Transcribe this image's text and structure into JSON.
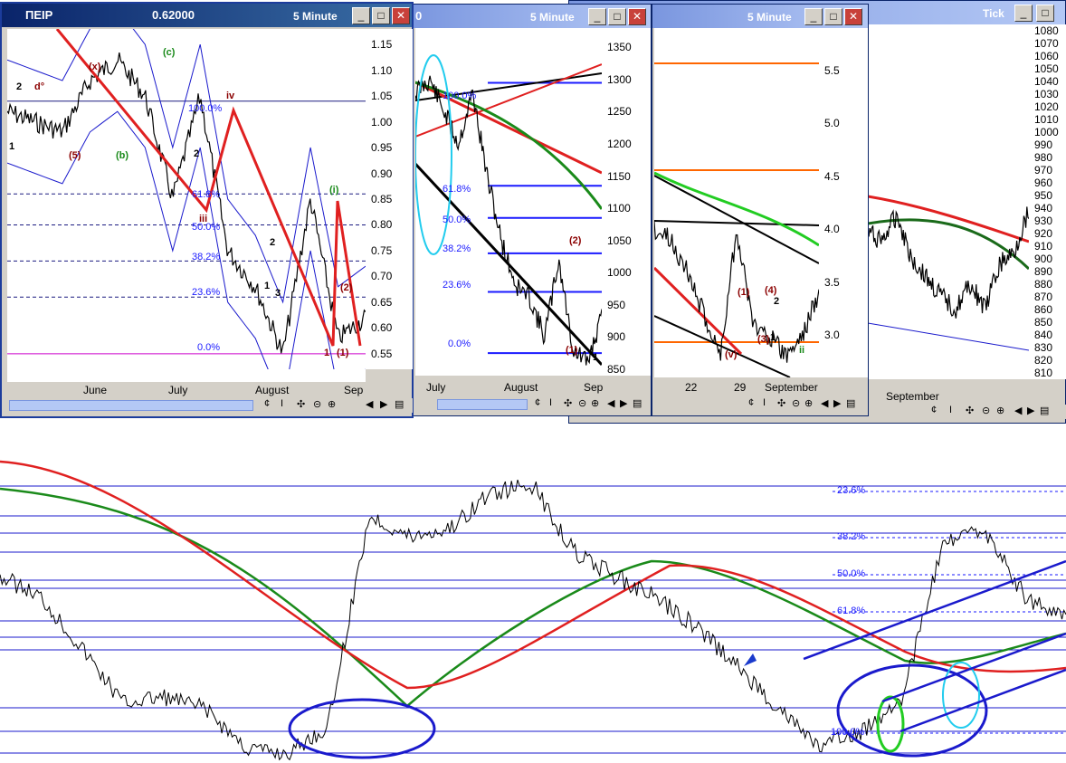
{
  "windows": [
    {
      "symbol": "ΠΕΙΡ",
      "value": "0.62000",
      "interval": "5 Minute",
      "y_ticks": [
        "1.15",
        "1.10",
        "1.05",
        "1.00",
        "0.95",
        "0.90",
        "0.85",
        "0.80",
        "0.75",
        "0.70",
        "0.65",
        "0.60",
        "0.55"
      ],
      "x_ticks": [
        "June",
        "July",
        "August",
        "Sep"
      ],
      "fib_levels": [
        "100.0%",
        "61.8%",
        "50.0%",
        "38.2%",
        "23.6%",
        "0.0%"
      ],
      "wave_labels": [
        "(x)",
        "(c)",
        "2",
        "d°",
        "1",
        "(5)",
        "(b)",
        "iv",
        "iii",
        "2",
        "(i)",
        "(1)",
        "(2)",
        "1",
        "1",
        "2",
        "3"
      ]
    },
    {
      "symbol": "0",
      "interval": "5 Minute",
      "y_ticks": [
        "1350",
        "1300",
        "1250",
        "1200",
        "1150",
        "1100",
        "1050",
        "1000",
        "950",
        "900",
        "850"
      ],
      "x_ticks": [
        "July",
        "August",
        "Sep"
      ],
      "fib_levels": [
        "100.0%",
        "61.8%",
        "50.0%",
        "38.2%",
        "23.6%",
        "0.0%"
      ],
      "wave_labels": [
        "(2)",
        "(1)",
        "1"
      ]
    },
    {
      "interval": "5 Minute",
      "y_ticks": [
        "5.5",
        "5.0",
        "4.5",
        "4.0",
        "3.5",
        "3.0"
      ],
      "x_ticks": [
        "22",
        "29",
        "September"
      ],
      "wave_labels": [
        "(v)",
        "(1)",
        "(4)",
        "(3)",
        "ii",
        "1",
        "2"
      ]
    },
    {
      "interval": "Tick",
      "y_ticks": [
        "1080",
        "1070",
        "1060",
        "1050",
        "1040",
        "1030",
        "1020",
        "1010",
        "1000",
        "990",
        "980",
        "970",
        "960",
        "950",
        "940",
        "930",
        "920",
        "910",
        "900",
        "890",
        "880",
        "870",
        "860",
        "850",
        "840",
        "830",
        "820",
        "810"
      ],
      "x_ticks": [
        "September"
      ]
    }
  ],
  "toolbar_icons": [
    "¢",
    "I",
    "✣",
    "⊝",
    "⊕",
    "◀",
    "▶",
    "▤"
  ],
  "main_chart": {
    "fib_levels": [
      "23.6%",
      "38.2%",
      "50.0%",
      "61.8%",
      "100.0%"
    ]
  },
  "colors": {
    "moving_avg_fast": "#1a8a1a",
    "moving_avg_slow": "#e02020",
    "bands": "#1a1acc",
    "fib_lines": "#1a1aff",
    "price": "#000000"
  },
  "chart_data": [
    {
      "type": "line",
      "symbol": "ΠΕΙΡ",
      "interval": "5 Minute",
      "last_value": 0.62,
      "ylim": [
        0.52,
        1.18
      ],
      "categories": [
        "June",
        "July",
        "August",
        "Sep"
      ],
      "series": [
        {
          "values": [
            1.02,
            1.0,
            0.98,
            1.08,
            1.12,
            1.05,
            0.85,
            1.05,
            0.75,
            0.68,
            0.55,
            0.85,
            0.58,
            0.62
          ]
        }
      ],
      "fib_levels": {
        "100.0%": 1.04,
        "61.8%": 0.86,
        "50.0%": 0.8,
        "38.2%": 0.73,
        "23.6%": 0.66,
        "0.0%": 0.55
      }
    },
    {
      "type": "line",
      "interval": "5 Minute",
      "ylim": [
        840,
        1380
      ],
      "categories": [
        "July",
        "August",
        "Sep"
      ],
      "series": [
        {
          "values": [
            1280,
            1300,
            1250,
            1200,
            1280,
            1150,
            1050,
            980,
            960,
            900,
            1020,
            880,
            860,
            930
          ]
        }
      ],
      "fib_levels": {
        "100.0%": 1295,
        "61.8%": 1135,
        "50.0%": 1085,
        "38.2%": 1030,
        "23.6%": 970,
        "0.0%": 875
      }
    },
    {
      "type": "line",
      "interval": "5 Minute",
      "ylim": [
        2.6,
        5.9
      ],
      "categories": [
        "22",
        "29",
        "September"
      ],
      "series": [
        {
          "values": [
            4.0,
            3.9,
            3.6,
            3.2,
            2.8,
            4.0,
            3.1,
            3.0,
            2.8,
            3.0,
            3.4
          ]
        }
      ]
    },
    {
      "type": "line",
      "interval": "Tick",
      "ylim": [
        805,
        1085
      ],
      "categories": [
        "September"
      ],
      "series": [
        {
          "values": [
            920,
            915,
            935,
            900,
            885,
            870,
            860,
            880,
            860,
            895,
            905,
            940
          ]
        }
      ]
    },
    {
      "type": "line",
      "fib_levels": [
        "23.6%",
        "38.2%",
        "50.0%",
        "61.8%",
        "100.0%"
      ],
      "series": [
        {
          "values": [
            0.62,
            0.55,
            0.38,
            0.2,
            0.22,
            0.18,
            0.05,
            0.03,
            0.12,
            0.82,
            0.75,
            0.78,
            0.9,
            0.92,
            0.7,
            0.62,
            0.55,
            0.45,
            0.32,
            0.18,
            0.05,
            0.1,
            0.22,
            0.72,
            0.78,
            0.55,
            0.48
          ]
        }
      ]
    }
  ]
}
